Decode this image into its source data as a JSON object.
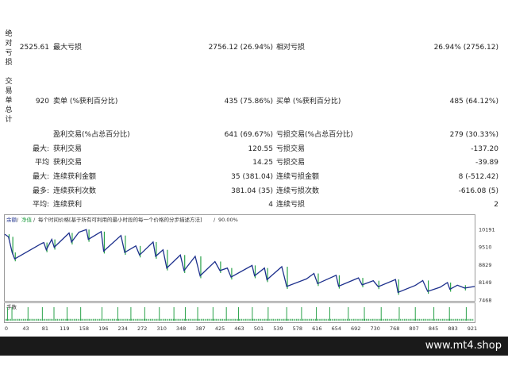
{
  "report": {
    "vlabels": [
      {
        "chars": [
          "绝",
          "对",
          "亏",
          "损"
        ]
      },
      {
        "chars": [
          "交",
          "易",
          "单",
          "总",
          "计"
        ]
      }
    ],
    "rows": [
      {
        "c1": "2525.61",
        "c2": "最大亏损",
        "c3": "2756.12 (26.94%)",
        "c4": "相对亏损",
        "c5": "26.94% (2756.12)"
      },
      {
        "c1": "920",
        "c2": "卖单 (%获利百分比)",
        "c3": "435 (75.86%)",
        "c4": "买单 (%获利百分比)",
        "c5": "485 (64.12%)"
      },
      {
        "c1": "",
        "c2": "盈利交易(%占总百分比)",
        "c3": "641 (69.67%)",
        "c4": "亏损交易(%占总百分比)",
        "c5": "279 (30.33%)"
      },
      {
        "c1": "最大:",
        "c2": "获利交易",
        "c3": "120.55",
        "c4": "亏损交易",
        "c5": "-137.20"
      },
      {
        "c1": "平均",
        "c2": "获利交易",
        "c3": "14.25",
        "c4": "亏损交易",
        "c5": "-39.89"
      },
      {
        "c1": "最大:",
        "c2": "连续获利金额",
        "c3": "35 (381.04)",
        "c4": "连续亏损金额",
        "c5": "8 (-512.42)"
      },
      {
        "c1": "最多:",
        "c2": "连续获利次数",
        "c3": "381.04 (35)",
        "c4": "连续亏损次数",
        "c5": "-616.08 (5)"
      },
      {
        "c1": "平均:",
        "c2": "连续获利",
        "c3": "4",
        "c4": "连续亏损",
        "c5": "2"
      }
    ]
  },
  "chart": {
    "header": {
      "balance_label": "余额",
      "equity_label": "净值",
      "description": "每个时间价格[基于所有可利用的最小时段的每一个价格的分步描述方法]",
      "quality": "90.00%"
    },
    "lot_label": "手数",
    "colors": {
      "balance": "#1c2f8c",
      "equity": "#2aa24a",
      "lots": "#2aa24a",
      "border": "#9a9a9a"
    }
  },
  "chart_data": {
    "type": "line",
    "x_ticks": [
      "0",
      "43",
      "81",
      "119",
      "158",
      "196",
      "234",
      "272",
      "310",
      "348",
      "387",
      "425",
      "463",
      "501",
      "539",
      "578",
      "616",
      "654",
      "692",
      "730",
      "768",
      "807",
      "845",
      "883",
      "921"
    ],
    "y_ticks": [
      "10191",
      "9510",
      "8829",
      "8149",
      "7468"
    ],
    "ylim": [
      7468,
      10400
    ],
    "xlim": [
      0,
      921
    ],
    "series": [
      {
        "name": "余额",
        "points": [
          [
            0,
            10000
          ],
          [
            15,
            9900
          ],
          [
            30,
            9300
          ],
          [
            40,
            9050
          ],
          [
            150,
            9650
          ],
          [
            158,
            9680
          ],
          [
            168,
            9400
          ],
          [
            190,
            9800
          ],
          [
            200,
            9500
          ],
          [
            260,
            10050
          ],
          [
            270,
            9700
          ],
          [
            300,
            10080
          ],
          [
            330,
            10180
          ],
          [
            338,
            9800
          ],
          [
            390,
            10100
          ],
          [
            400,
            9350
          ],
          [
            470,
            9950
          ],
          [
            485,
            9300
          ],
          [
            530,
            9550
          ],
          [
            545,
            9200
          ],
          [
            600,
            9700
          ],
          [
            610,
            9150
          ],
          [
            640,
            9400
          ],
          [
            655,
            8700
          ],
          [
            710,
            9200
          ],
          [
            725,
            8600
          ],
          [
            770,
            9150
          ],
          [
            790,
            8400
          ],
          [
            850,
            8950
          ],
          [
            870,
            8600
          ],
          [
            900,
            8700
          ],
          [
            915,
            8350
          ],
          [
            1000,
            8800
          ],
          [
            1010,
            8400
          ],
          [
            1050,
            8700
          ],
          [
            1060,
            8250
          ],
          [
            1120,
            8750
          ],
          [
            1140,
            7990
          ],
          [
            1220,
            8280
          ],
          [
            1250,
            8490
          ],
          [
            1265,
            8100
          ],
          [
            1340,
            8420
          ],
          [
            1350,
            8000
          ],
          [
            1430,
            8320
          ],
          [
            1445,
            8050
          ],
          [
            1490,
            8210
          ],
          [
            1510,
            7980
          ],
          [
            1580,
            8260
          ],
          [
            1590,
            7760
          ],
          [
            1660,
            8030
          ],
          [
            1690,
            8220
          ],
          [
            1710,
            7800
          ],
          [
            1760,
            7960
          ],
          [
            1790,
            8140
          ],
          [
            1800,
            7880
          ],
          [
            1830,
            8040
          ],
          [
            1860,
            7930
          ],
          [
            1900,
            7990
          ]
        ]
      }
    ],
    "lots": {
      "baseline": 0.1,
      "spike_positions": [
        11,
        29,
        94,
        152,
        199,
        252,
        307,
        393,
        457,
        510,
        566,
        625,
        684,
        730,
        780,
        842,
        896,
        945,
        1001,
        1065,
        1140,
        1200,
        1260,
        1314,
        1389,
        1454,
        1522,
        1595,
        1660,
        1735,
        1798,
        1866
      ]
    }
  },
  "footer": {
    "brand": "www.mt4.shop"
  }
}
